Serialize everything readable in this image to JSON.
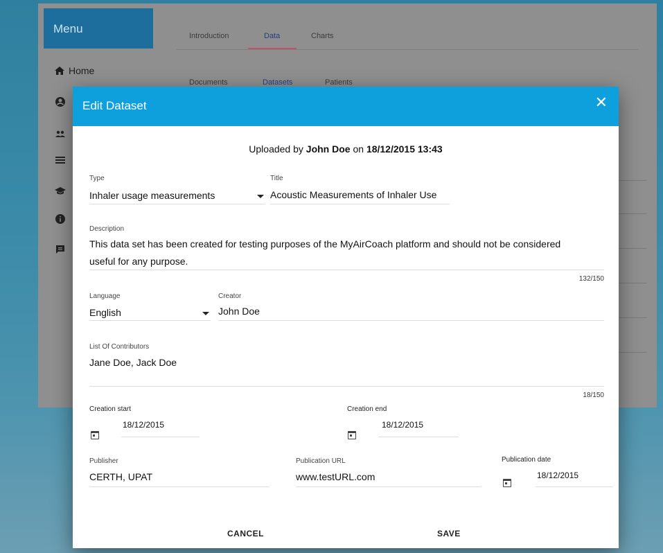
{
  "menu": {
    "title": "Menu",
    "home_label": "Home"
  },
  "tabs": [
    "Introduction",
    "Data",
    "Charts"
  ],
  "subtabs": [
    "Documents",
    "Datasets",
    "Patients"
  ],
  "dialog": {
    "title": "Edit Dataset",
    "close_icon": "close-icon",
    "uploaded_prefix": "Uploaded by",
    "uploaded_user": "John Doe",
    "uploaded_on": "on",
    "uploaded_date": "18/12/2015 13:43",
    "type": {
      "label": "Type",
      "value": "Inhaler usage measurements"
    },
    "title_field": {
      "label": "Title",
      "value": "Acoustic Measurements of Inhaler Use"
    },
    "description": {
      "label": "Description",
      "line1": "This data set has been created for testing purposes of the MyAirCoach platform and should not be considered",
      "line2": "useful for any purpose.",
      "counter": "132/150"
    },
    "language": {
      "label": "Language",
      "value": "English"
    },
    "creator": {
      "label": "Creator",
      "value": "John Doe"
    },
    "contributors": {
      "label": "List Of Contributors",
      "value": "Jane Doe, Jack Doe",
      "counter": "18/150"
    },
    "creation_start": {
      "label": "Creation start",
      "value": "18/12/2015"
    },
    "creation_end": {
      "label": "Creation end",
      "value": "18/12/2015"
    },
    "publisher": {
      "label": "Publisher",
      "value": "CERTH, UPAT"
    },
    "publication_url": {
      "label": "Publication URL",
      "value": "www.testURL.com"
    },
    "publication_date": {
      "label": "Publication date",
      "value": "18/12/2015"
    },
    "cancel_label": "CANCEL",
    "save_label": "SAVE"
  },
  "colors": {
    "header": "#0ea0dd",
    "menu_header": "#1d6e9c",
    "tab_active_underline": "#c0516b"
  }
}
